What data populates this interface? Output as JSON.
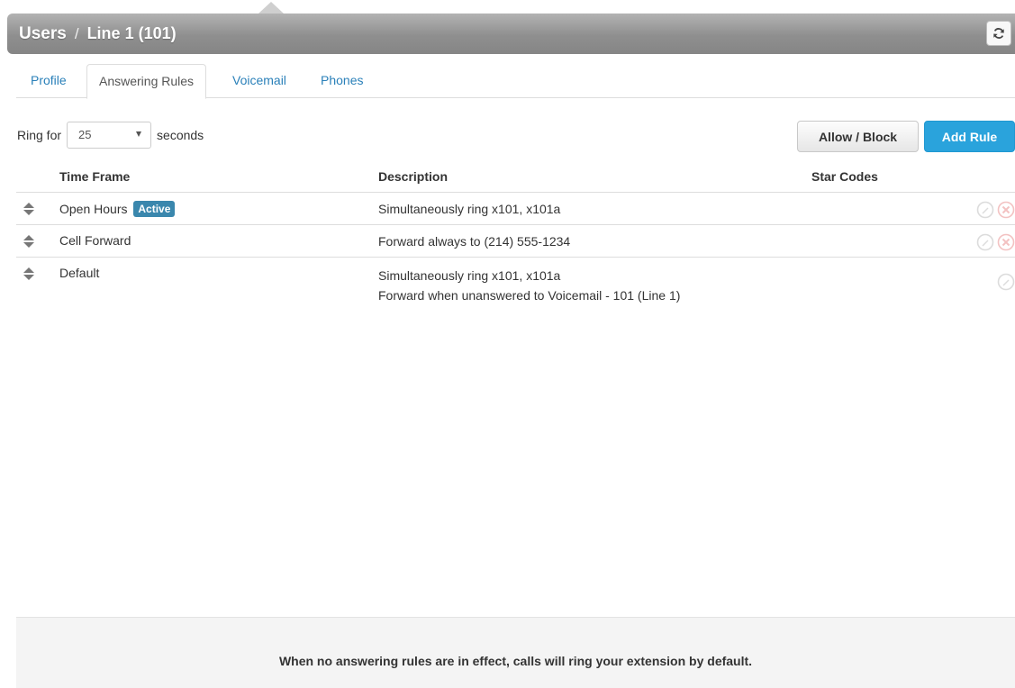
{
  "header": {
    "section": "Users",
    "separator": "/",
    "subtitle": "Line 1 (101)",
    "refresh_icon": "refresh-icon"
  },
  "tabs": [
    {
      "label": "Profile",
      "active": false
    },
    {
      "label": "Answering Rules",
      "active": true
    },
    {
      "label": "Voicemail",
      "active": false
    },
    {
      "label": "Phones",
      "active": false
    }
  ],
  "ring": {
    "prefix": "Ring for",
    "value": "25",
    "suffix": "seconds"
  },
  "buttons": {
    "allow_block": "Allow / Block",
    "add_rule": "Add Rule"
  },
  "table": {
    "columns": {
      "time_frame": "Time Frame",
      "description": "Description",
      "star_codes": "Star Codes"
    },
    "rows": [
      {
        "time_frame": "Open Hours",
        "badge": "Active",
        "description": [
          "Simultaneously ring x101, x101a"
        ],
        "actions": [
          "edit-icon",
          "delete-icon"
        ]
      },
      {
        "time_frame": "Cell Forward",
        "badge": "",
        "description": [
          "Forward always to (214) 555-1234"
        ],
        "actions": [
          "edit-icon",
          "delete-icon"
        ]
      },
      {
        "time_frame": "Default",
        "badge": "",
        "description": [
          "Simultaneously ring x101, x101a",
          "Forward when unanswered to Voicemail - 101 (Line 1)"
        ],
        "actions": [
          "edit-icon"
        ]
      }
    ]
  },
  "footer": {
    "message": "When no answering rules are in effect, calls will ring your extension by default."
  },
  "colors": {
    "accent": "#2aa3dc",
    "link": "#2a80b9",
    "badge": "#3a87ad",
    "header_gray": "#8f8f8f"
  }
}
